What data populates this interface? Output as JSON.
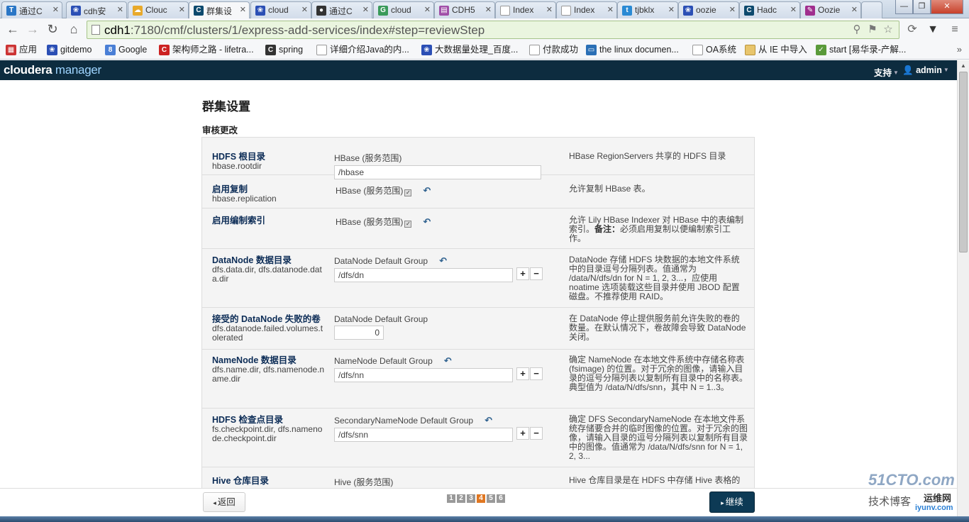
{
  "browser": {
    "tabs": [
      {
        "label": "通过C",
        "icon": "T",
        "color": "#2a76c6"
      },
      {
        "label": "cdh安",
        "icon": "paw",
        "color": "#2b4fb5"
      },
      {
        "label": "Clouc",
        "icon": "cloud",
        "color": "#e8a92a"
      },
      {
        "label": "群集设",
        "icon": "C",
        "color": "#0d4a6e",
        "active": true
      },
      {
        "label": "cloud",
        "icon": "paw",
        "color": "#2b4fb5"
      },
      {
        "label": "通过C",
        "icon": "penguin",
        "color": "#333"
      },
      {
        "label": "cloud",
        "icon": "G",
        "color": "#3a9a5a"
      },
      {
        "label": "CDH5",
        "icon": "doc",
        "color": "#a14fa8"
      },
      {
        "label": "Index",
        "icon": "page",
        "color": "#fff"
      },
      {
        "label": "Index",
        "icon": "page",
        "color": "#fff"
      },
      {
        "label": "tjbklx",
        "icon": "t",
        "color": "#2a8ad4"
      },
      {
        "label": "oozie",
        "icon": "paw",
        "color": "#2b4fb5"
      },
      {
        "label": "Hadc",
        "icon": "C",
        "color": "#0d4a6e"
      },
      {
        "label": "Oozie",
        "icon": "feather",
        "color": "#a02e8e"
      }
    ],
    "url_host": "cdh1",
    "url_rest": ":7180/cmf/clusters/1/express-add-services/index#step=reviewStep",
    "bookmarks": [
      {
        "label": "应用",
        "icon": "grid"
      },
      {
        "label": "gitdemo",
        "icon": "paw"
      },
      {
        "label": "Google",
        "icon": "G"
      },
      {
        "label": "架构师之路 - lifetra...",
        "icon": "C"
      },
      {
        "label": "spring",
        "icon": "C"
      },
      {
        "label": "详细介绍Java的内...",
        "icon": "page"
      },
      {
        "label": "大数据量处理_百度...",
        "icon": "paw"
      },
      {
        "label": "付款成功",
        "icon": "page"
      },
      {
        "label": "the linux documen...",
        "icon": "monitor"
      },
      {
        "label": "OA系统",
        "icon": "page"
      },
      {
        "label": "从 IE 中导入",
        "icon": "folder"
      },
      {
        "label": "start [易华录-产解...",
        "icon": "check"
      }
    ]
  },
  "app": {
    "logo_bold": "cloudera",
    "logo_light": " manager",
    "support_label": "支持",
    "user_label": "admin"
  },
  "page": {
    "title": "群集设置",
    "subtitle": "审核更改"
  },
  "rows": [
    {
      "name": "HDFS 根目录",
      "key": "hbase.rootdir",
      "group": "HBase (服务范围)",
      "value": "/hbase",
      "desc": "HBase RegionServers 共享的 HDFS 目录"
    },
    {
      "name": "启用复制",
      "key": "hbase.replication",
      "group": "HBase (服务范围)",
      "desc": "允许复制 HBase 表。"
    },
    {
      "name": "启用编制索引",
      "key": "",
      "group": "HBase (服务范围)",
      "desc_pre": "允许 Lily HBase Indexer 对 HBase 中的表编制索引。",
      "desc_bold": "备注：",
      "desc_post": "必须启用复制以便编制索引工作。"
    },
    {
      "name": "DataNode 数据目录",
      "key": "dfs.data.dir, dfs.datanode.data.dir",
      "group": "DataNode Default Group",
      "value": "/dfs/dn",
      "desc": "DataNode 存储 HDFS 块数据的本地文件系统中的目录逗号分隔列表。值通常为 /data/N/dfs/dn for N = 1, 2, 3...，应使用 noatime 选项装载这些目录并使用 JBOD 配置磁盘。不推荐使用 RAID。"
    },
    {
      "name": "接受的 DataNode 失败的卷",
      "key": "dfs.datanode.failed.volumes.tolerated",
      "group": "DataNode Default Group",
      "value": "0",
      "desc": "在 DataNode 停止提供服务前允许失败的卷的数量。在默认情况下，卷故障会导致 DataNode 关闭。"
    },
    {
      "name": "NameNode 数据目录",
      "key": "dfs.name.dir, dfs.namenode.name.dir",
      "group": "NameNode Default Group",
      "value": "/dfs/nn",
      "desc": "确定 NameNode 在本地文件系统中存储名称表 (fsimage) 的位置。对于冗余的图像，请输入目录的逗号分隔列表以复制所有目录中的名称表。典型值为 /data/N/dfs/snn，其中 N = 1..3。"
    },
    {
      "name": "HDFS 检查点目录",
      "key": "fs.checkpoint.dir, dfs.namenode.checkpoint.dir",
      "group": "SecondaryNameNode Default Group",
      "value": "/dfs/snn",
      "desc": "确定 DFS SecondaryNameNode 在本地文件系统存储要合并的临时图像的位置。对于冗余的图像，请输入目录的逗号分隔列表以复制所有目录中的图像。值通常为 /data/N/dfs/snn for N = 1, 2, 3..."
    },
    {
      "name": "Hive 仓库目录",
      "key": "",
      "group": "Hive (服务范围)",
      "desc": "Hive 仓库目录是在 HDFS 中存储 Hive 表格的"
    }
  ],
  "footer": {
    "back_label": "返回",
    "next_label": "继续",
    "steps": [
      "1",
      "2",
      "3",
      "4",
      "5",
      "6"
    ],
    "current_step": 4
  },
  "watermark": {
    "line1": "51CTO.com",
    "line2": "技术博客",
    "line3": "运维网",
    "line4": "iyunv.com"
  },
  "colors": {
    "app_header": "#0d2c3f",
    "step_current": "#e07722",
    "continue_button": "#0d3a55",
    "omnibox": "#eaf5df"
  }
}
